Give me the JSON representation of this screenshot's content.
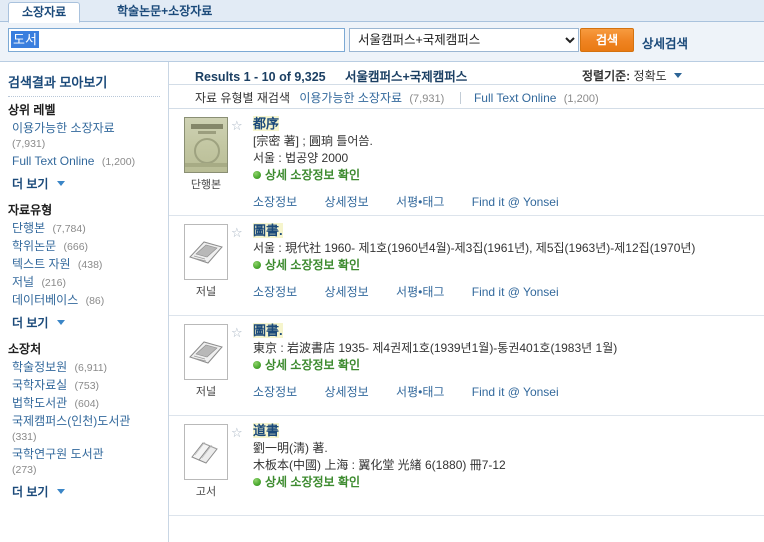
{
  "tabs": [
    {
      "label": "소장자료",
      "active": true
    },
    {
      "label": "학술논문+소장자료",
      "active": false
    }
  ],
  "search": {
    "query": "도서",
    "placeholder": "",
    "scope_selected": "서울캠퍼스+국제캠퍼스",
    "scope_options": [
      "서울캠퍼스+국제캠퍼스"
    ],
    "button_label": "검색",
    "advanced_label": "상세검색"
  },
  "sidebar": {
    "title": "검색결과 모아보기",
    "groups": [
      {
        "head": "상위 레벨",
        "items": [
          {
            "label": "이용가능한 소장자료",
            "count": "(7,931)",
            "wrap": true
          },
          {
            "label": "Full Text Online",
            "count": "(1,200)",
            "wrap": false
          }
        ],
        "more_label": "더 보기"
      },
      {
        "head": "자료유형",
        "items": [
          {
            "label": "단행본",
            "count": "(7,784)",
            "wrap": false
          },
          {
            "label": "학위논문",
            "count": "(666)",
            "wrap": false
          },
          {
            "label": "텍스트 자원",
            "count": "(438)",
            "wrap": false
          },
          {
            "label": "저널",
            "count": "(216)",
            "wrap": false
          },
          {
            "label": "데이터베이스",
            "count": "(86)",
            "wrap": false
          }
        ],
        "more_label": "더 보기"
      },
      {
        "head": "소장처",
        "items": [
          {
            "label": "학술정보원",
            "count": "(6,911)",
            "wrap": false
          },
          {
            "label": "국학자료실",
            "count": "(753)",
            "wrap": false
          },
          {
            "label": "법학도서관",
            "count": "(604)",
            "wrap": false
          },
          {
            "label": "국제캠퍼스(인천)도서관",
            "count": "(331)",
            "wrap": true
          },
          {
            "label": "국학연구원 도서관",
            "count": "(273)",
            "wrap": true
          }
        ],
        "more_label": "더 보기"
      }
    ]
  },
  "results_header": {
    "count_text": "Results 1 - 10 of 9,325",
    "scope_text": "서울캠퍼스+국제캠퍼스",
    "sort_label": "정렬기준:",
    "sort_value": "정확도"
  },
  "refine_bar": {
    "label": "자료 유형별 재검색",
    "links": [
      {
        "label": "이용가능한 소장자료",
        "count": "(7,931)"
      },
      {
        "label": "Full Text Online",
        "count": "(1,200)"
      }
    ]
  },
  "actions": {
    "holdings": "소장정보",
    "details": "상세정보",
    "reviews": "서평•태그",
    "findit": "Find it @ Yonsei"
  },
  "results": [
    {
      "title": "都序",
      "lines": [
        "[宗密 著] ; 圓珦 틀어씀.",
        "서울 : 법공양 2000"
      ],
      "availability": "상세 소장정보 확인",
      "format_label": "단행본",
      "thumb_kind": "book-cover"
    },
    {
      "title": "圖書.",
      "lines": [
        "서울 : 現代社 1960- 제1호(1960년4월)-제3집(1961년), 제5집(1963년)-제12집(1970년)"
      ],
      "availability": "상세 소장정보 확인",
      "format_label": "저널",
      "thumb_kind": "journal"
    },
    {
      "title": "圖書.",
      "lines": [
        "東京 : 岩波書店 1935- 제4권제1호(1939년1월)-통권401호(1983년 1월)"
      ],
      "availability": "상세 소장정보 확인",
      "format_label": "저널",
      "thumb_kind": "journal"
    },
    {
      "title": "道書",
      "lines": [
        "劉一明(淸) 著.",
        "木板本(中國) 上海 : 翼化堂 光緖 6(1880) 冊7-12"
      ],
      "availability": "상세 소장정보 확인",
      "format_label": "고서",
      "thumb_kind": "oldbook"
    }
  ],
  "colors": {
    "accent_orange": "#ef8321",
    "link_blue": "#33699c",
    "title_blue": "#1b4a7a",
    "available_green": "#3d8b2f",
    "highlight_yellow": "#f6f5cd",
    "selection_blue": "#3a7ede"
  }
}
